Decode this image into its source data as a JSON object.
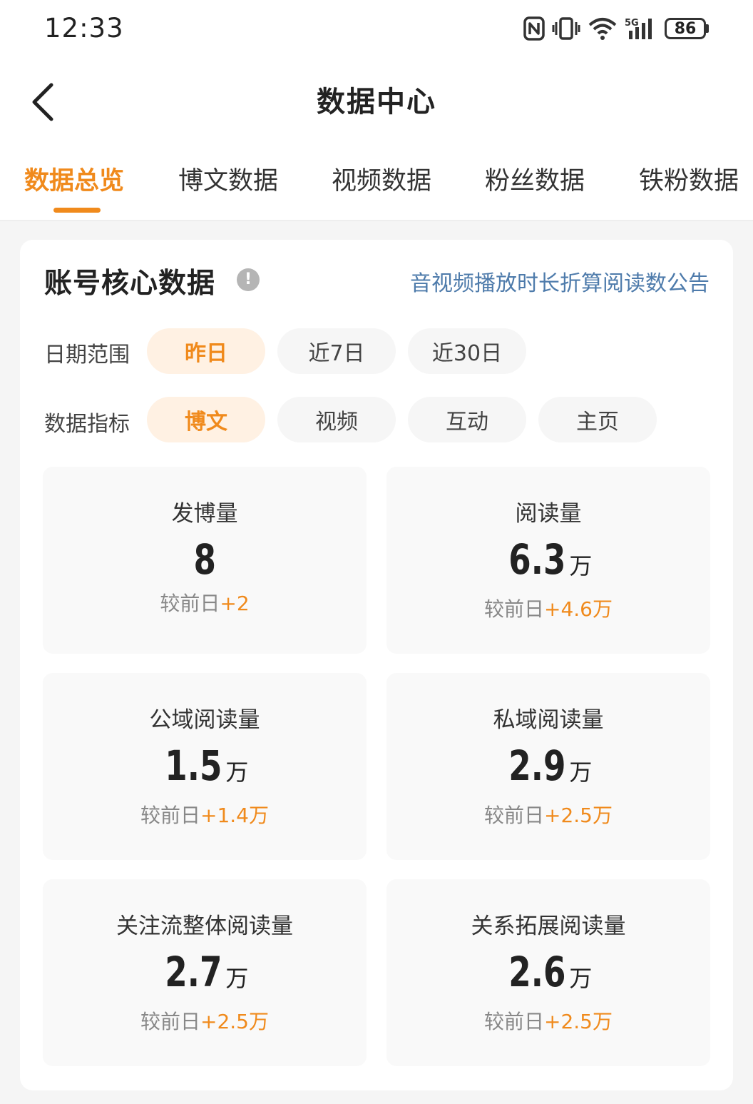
{
  "status_bar": {
    "time": "12:33",
    "network": "5G",
    "battery": "86"
  },
  "header": {
    "back_icon": "chevron-left-icon",
    "title": "数据中心"
  },
  "tabs": [
    {
      "label": "数据总览",
      "active": true
    },
    {
      "label": "博文数据",
      "active": false
    },
    {
      "label": "视频数据",
      "active": false
    },
    {
      "label": "粉丝数据",
      "active": false
    },
    {
      "label": "铁粉数据",
      "active": false
    }
  ],
  "card": {
    "title": "账号核心数据",
    "info_icon_glyph": "!",
    "notice_link": "音视频播放时长折算阅读数公告",
    "date_range": {
      "label": "日期范围",
      "options": [
        {
          "label": "昨日",
          "active": true
        },
        {
          "label": "近7日",
          "active": false
        },
        {
          "label": "近30日",
          "active": false
        }
      ]
    },
    "metric": {
      "label": "数据指标",
      "options": [
        {
          "label": "博文",
          "active": true
        },
        {
          "label": "视频",
          "active": false
        },
        {
          "label": "互动",
          "active": false
        },
        {
          "label": "主页",
          "active": false
        }
      ]
    },
    "stats": [
      {
        "label": "发博量",
        "value": "8",
        "unit": "",
        "delta_prefix": "较前日",
        "delta": "+2"
      },
      {
        "label": "阅读量",
        "value": "6.3",
        "unit": "万",
        "delta_prefix": "较前日",
        "delta": "+4.6万"
      },
      {
        "label": "公域阅读量",
        "value": "1.5",
        "unit": "万",
        "delta_prefix": "较前日",
        "delta": "+1.4万"
      },
      {
        "label": "私域阅读量",
        "value": "2.9",
        "unit": "万",
        "delta_prefix": "较前日",
        "delta": "+2.5万"
      },
      {
        "label": "关注流整体阅读量",
        "value": "2.7",
        "unit": "万",
        "delta_prefix": "较前日",
        "delta": "+2.5万"
      },
      {
        "label": "关系拓展阅读量",
        "value": "2.6",
        "unit": "万",
        "delta_prefix": "较前日",
        "delta": "+2.5万"
      }
    ]
  },
  "colors": {
    "accent": "#f08a1c",
    "link": "#4e7bab",
    "active_pill_bg": "#fff1e3"
  }
}
